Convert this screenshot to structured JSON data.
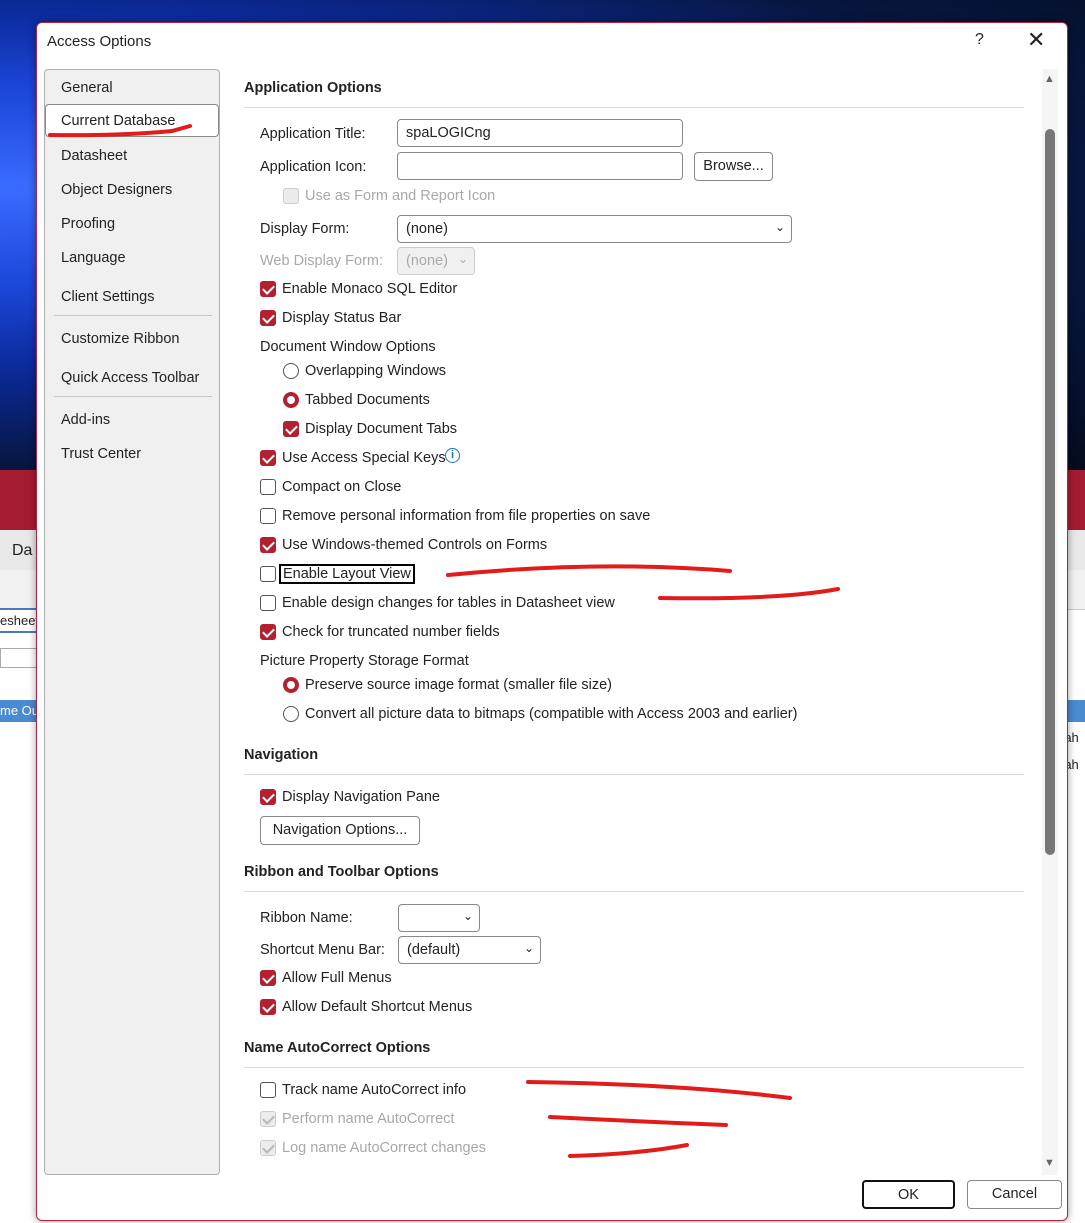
{
  "background": {
    "tab_fragment": "Da",
    "field_fragment": "esheet",
    "header_fragment": "me Ou",
    "row_fragments": [
      "rah",
      "rah"
    ]
  },
  "dialog": {
    "title": "Access Options",
    "help": "?",
    "close": "✕"
  },
  "sidebar": {
    "items": [
      {
        "label": "General"
      },
      {
        "label": "Current Database"
      },
      {
        "label": "Datasheet"
      },
      {
        "label": "Object Designers"
      },
      {
        "label": "Proofing"
      },
      {
        "label": "Language"
      },
      {
        "label": "Client Settings"
      },
      {
        "label": "Customize Ribbon"
      },
      {
        "label": "Quick Access Toolbar"
      },
      {
        "label": "Add-ins"
      },
      {
        "label": "Trust Center"
      }
    ]
  },
  "app": {
    "header": "Application Options",
    "title_label": "Application Title:",
    "title_value": "spaLOGICng",
    "icon_label": "Application Icon:",
    "icon_value": "",
    "browse": "Browse...",
    "use_as_icon": "Use as Form and Report Icon",
    "display_form_label": "Display Form:",
    "display_form_value": "(none)",
    "web_display_label": "Web Display Form:",
    "web_display_value": "(none)",
    "monaco": "Enable Monaco SQL Editor",
    "status_bar": "Display Status Bar",
    "doc_window": "Document Window Options",
    "overlapping": "Overlapping Windows",
    "tabbed": "Tabbed Documents",
    "doc_tabs": "Display Document Tabs",
    "special_keys": "Use Access Special Keys",
    "compact": "Compact on Close",
    "remove_personal": "Remove personal information from file properties on save",
    "windows_controls": "Use Windows-themed Controls on Forms",
    "layout_view": "Enable Layout View",
    "design_changes": "Enable design changes for tables in Datasheet view",
    "truncated": "Check for truncated number fields",
    "picture_storage": "Picture Property Storage Format",
    "preserve": "Preserve source image format (smaller file size)",
    "convert": "Convert all picture data to bitmaps (compatible with Access 2003 and earlier)"
  },
  "navigation": {
    "header": "Navigation",
    "display_pane": "Display Navigation Pane",
    "options_button": "Navigation Options..."
  },
  "ribbon": {
    "header": "Ribbon and Toolbar Options",
    "ribbon_name_label": "Ribbon Name:",
    "ribbon_name_value": "",
    "shortcut_label": "Shortcut Menu Bar:",
    "shortcut_value": "(default)",
    "full_menus": "Allow Full Menus",
    "default_shortcut": "Allow Default Shortcut Menus"
  },
  "autocorrect": {
    "header": "Name AutoCorrect Options",
    "track": "Track name AutoCorrect info",
    "perform": "Perform name AutoCorrect",
    "log": "Log name AutoCorrect changes"
  },
  "footer": {
    "ok": "OK",
    "cancel": "Cancel"
  },
  "colors": {
    "accent": "#b3202f",
    "annotation": "#e31b1b"
  }
}
